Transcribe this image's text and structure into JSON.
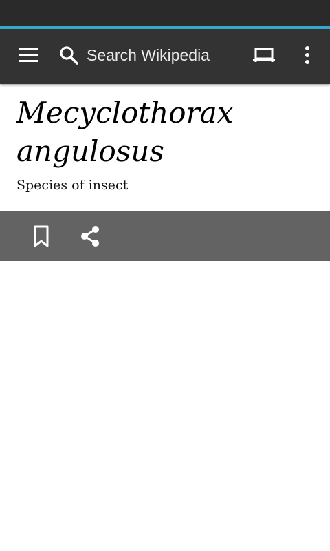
{
  "page_loading": {
    "progress_fraction": 1.0,
    "accent_color": "#33a8cc"
  },
  "toolbar": {
    "menu_icon": "hamburger-menu-icon",
    "search": {
      "icon": "search-icon",
      "placeholder": "Search Wikipedia"
    },
    "tabs_icon": "tabs-icon",
    "overflow_icon": "more-vert-icon"
  },
  "article": {
    "title": "Mecyclothorax angulosus",
    "description": "Species of insect"
  },
  "actions": {
    "bookmark_icon": "bookmark-icon",
    "share_icon": "share-icon"
  }
}
